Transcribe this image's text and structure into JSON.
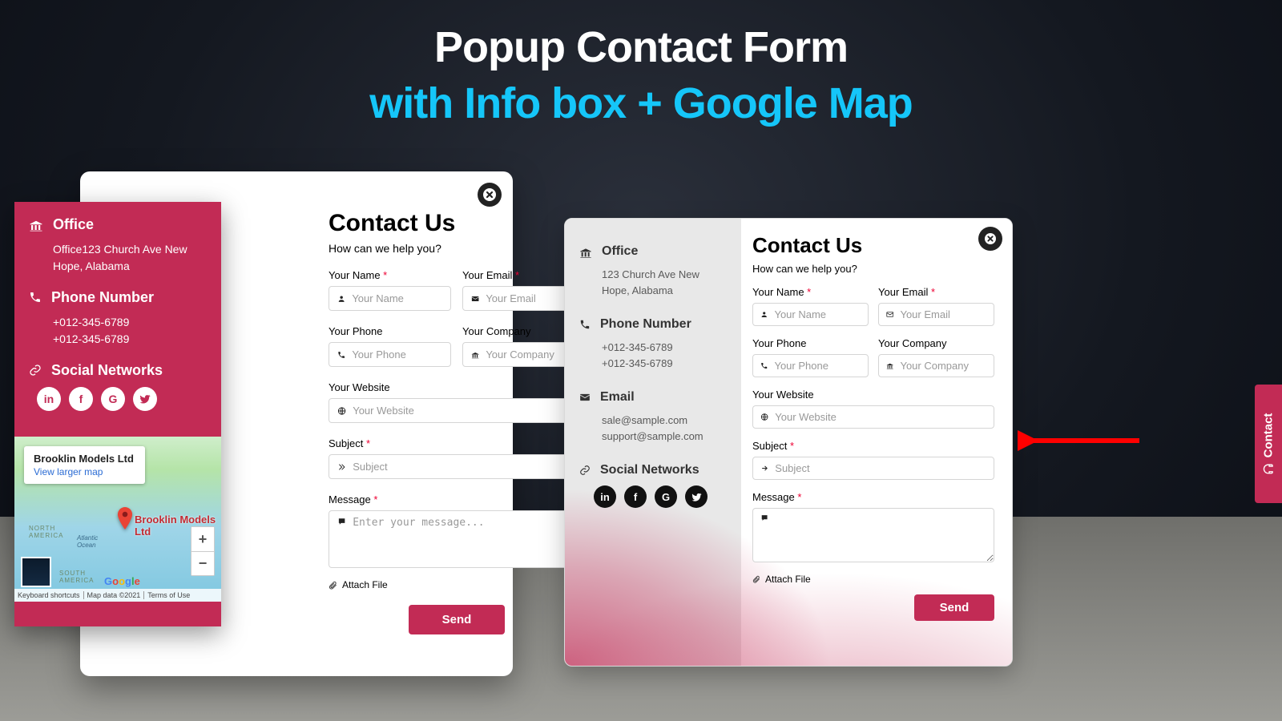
{
  "heading": {
    "line1": "Popup Contact Form",
    "line2": "with Info box + Google Map"
  },
  "cardA": {
    "sidebar": {
      "office_title": "Office",
      "office_lines": "Office123 Church Ave New Hope, Alabama",
      "phone_title": "Phone Number",
      "phone_lines": "+012-345-6789\n+012-345-6789",
      "social_title": "Social Networks"
    },
    "map": {
      "card_title": "Brooklin Models Ltd",
      "card_link": "View larger map",
      "pin_label": "Brooklin Models Ltd",
      "north_america": "NORTH\nAMERICA",
      "south_america": "SOUTH\nAMERICA",
      "atlantic": "Atlantic\nOcean",
      "logo1": "G",
      "logo2": "o",
      "logo3": "o",
      "logo4": "g",
      "logo5": "l",
      "logo6": "e",
      "foot_ks": "Keyboard shortcuts",
      "foot_md": "Map data ©2021",
      "foot_tou": "Terms of Use"
    },
    "form": {
      "title": "Contact Us",
      "subtitle": "How can we help you?",
      "name_label": "Your Name",
      "name_ph": "Your Name",
      "email_label": "Your Email",
      "email_ph": "Your Email",
      "phone_label": "Your Phone",
      "phone_ph": "Your Phone",
      "company_label": "Your Company",
      "company_ph": "Your Company",
      "website_label": "Your Website",
      "website_ph": "Your Website",
      "subject_label": "Subject",
      "subject_ph": "Subject",
      "message_label": "Message",
      "message_ph": "Enter your message...",
      "attach_label": "Attach File",
      "send_label": "Send",
      "star": " *"
    }
  },
  "cardB": {
    "sidebar": {
      "office_title": "Office",
      "office_lines": "123 Church Ave New Hope, Alabama",
      "phone_title": "Phone Number",
      "phone_lines": "+012-345-6789\n+012-345-6789",
      "email_title": "Email",
      "email_lines": "sale@sample.com\nsupport@sample.com",
      "social_title": "Social Networks"
    },
    "form": {
      "title": "Contact Us",
      "subtitle": "How can we help you?",
      "name_label": "Your Name",
      "name_ph": "Your Name",
      "email_label": "Your Email",
      "email_ph": "Your Email",
      "phone_label": "Your Phone",
      "phone_ph": "Your Phone",
      "company_label": "Your Company",
      "company_ph": "Your Company",
      "website_label": "Your Website",
      "website_ph": "Your Website",
      "subject_label": "Subject",
      "subject_ph": "Subject",
      "message_label": "Message",
      "attach_label": "Attach File",
      "send_label": "Send",
      "star": " *"
    }
  },
  "sidetab": {
    "label": "Contact"
  },
  "social_glyphs": {
    "in": "in",
    "f": "f",
    "g": "G",
    "t": "t"
  },
  "colors": {
    "brand": "#c22b55",
    "accent": "#15c6f9"
  }
}
